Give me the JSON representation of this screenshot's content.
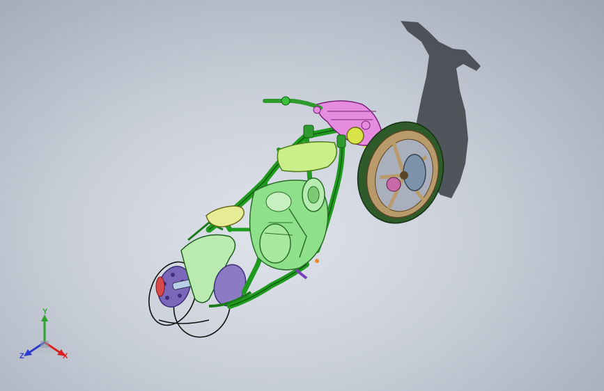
{
  "viewport": {
    "background_top": "#cdd3dc",
    "background_bottom": "#a3abb8"
  },
  "model": {
    "frame_color": "#1e9b1e",
    "engine_color": "#8fe08a",
    "tank_color": "#c9ee8a",
    "seat_color": "#e6ec95",
    "front_wheel_rim": "#b99a6a",
    "front_tire": "#2f5a2a",
    "rear_sprocket": "#7a67b8",
    "head_assembly": "#e58be0",
    "shadow_color": "#3b3f47"
  },
  "triad": {
    "y_label": "Y",
    "x_label": "X",
    "z_label": "Z",
    "y_color": "#2ea12e",
    "x_color": "#d92121",
    "z_color": "#2b3dd1"
  }
}
